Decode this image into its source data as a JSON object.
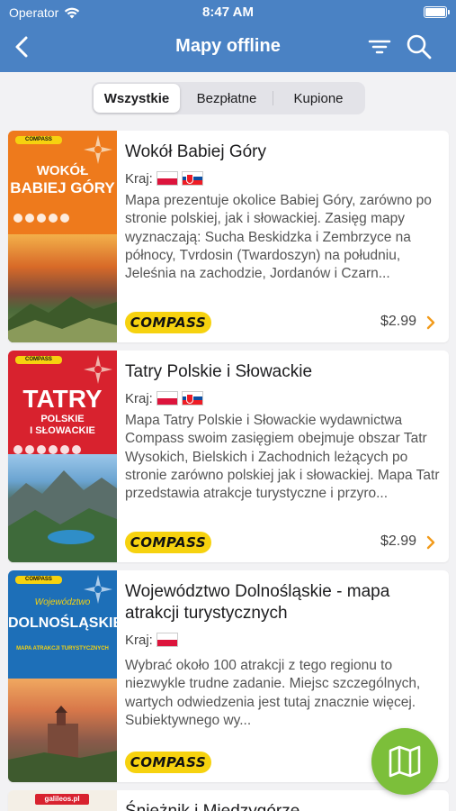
{
  "status_bar": {
    "carrier": "Operator",
    "time": "8:47 AM"
  },
  "nav": {
    "title": "Mapy offline"
  },
  "segments": [
    "Wszystkie",
    "Bezpłatne",
    "Kupione"
  ],
  "active_segment": "Wszystkie",
  "colors": {
    "header": "#4a82c4",
    "fab": "#7cbf3a",
    "chevron": "#f29b1b",
    "compass": "#f6d20f"
  },
  "cards": [
    {
      "title": "Wokół Babiej Góry",
      "country_label": "Kraj:",
      "flags": [
        "pl",
        "sk"
      ],
      "description": "Mapa prezentuje okolice Babiej Góry, zarówno po stronie polskiej, jak i słowackiej. Zasięg mapy wyznaczają: Sucha Beskidzka i Zembrzyce na północy, Tvrdosin (Twardoszyn) na południu, Jeleśnia na zachodzie, Jordanów i Czarn...",
      "publisher": "COMPASS",
      "price": "$2.99",
      "cover": {
        "logo": "COMPASS",
        "title_line1": "WOKÓŁ",
        "title_line2": "BABIEJ GÓRY"
      }
    },
    {
      "title": "Tatry Polskie i Słowackie",
      "country_label": "Kraj:",
      "flags": [
        "pl",
        "sk"
      ],
      "description": "Mapa Tatry Polskie i Słowackie wydawnictwa Compass swoim zasięgiem obejmuje obszar Tatr Wysokich, Bielskich i Zachodnich leżących po stronie zarówno polskiej jak i słowackiej. Mapa Tatr przedstawia atrakcje turystyczne i przyro...",
      "publisher": "COMPASS",
      "price": "$2.99",
      "cover": {
        "logo": "COMPASS",
        "title_line1": "TATRY",
        "title_line2": "POLSKIE",
        "title_line3": "I SŁOWACKIE"
      }
    },
    {
      "title": "Województwo Dolnośląskie - mapa atrakcji turystycznych",
      "country_label": "Kraj:",
      "flags": [
        "pl"
      ],
      "description": "Wybrać około 100 atrakcji z tego regionu to niezwykle trudne zadanie. Miejsc szczególnych, wartych odwiedzenia jest tutaj znacznie więcej. Subiektywnego wy...",
      "publisher": "COMPASS",
      "price": "",
      "cover": {
        "logo": "COMPASS",
        "title_line0": "Województwo",
        "title_line1": "DOLNOŚLĄSKIE",
        "title_line2": "MAPA ATRAKCJI TURYSTYCZNYCH"
      }
    },
    {
      "title": "Śnieżnik i Międzygórze",
      "cover": {
        "logo": "galileos.pl"
      }
    }
  ]
}
